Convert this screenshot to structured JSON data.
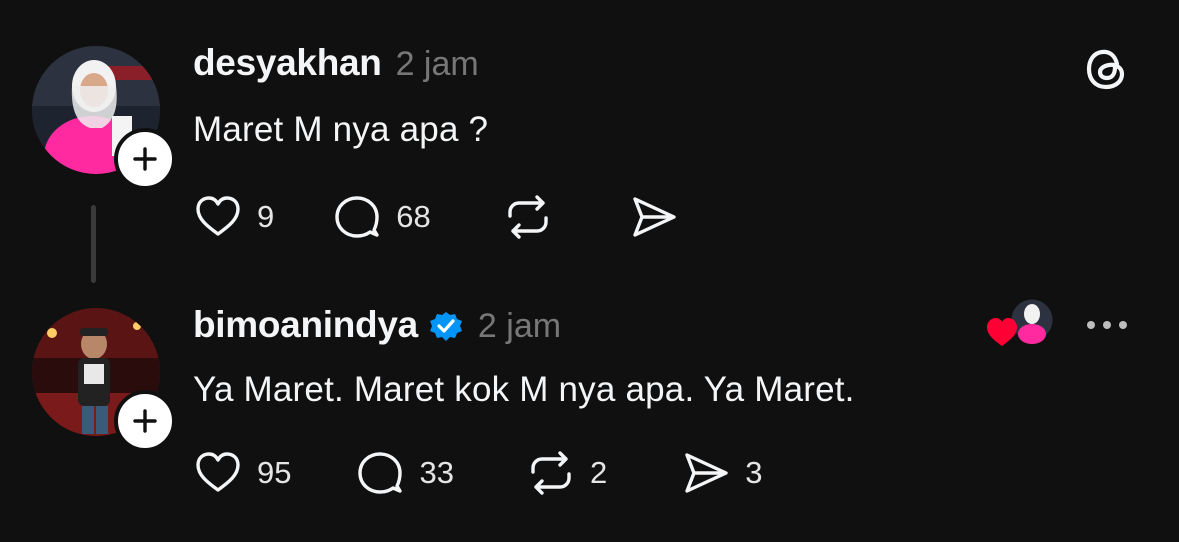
{
  "posts": [
    {
      "username": "desyakhan",
      "time": "2 jam",
      "text": "Maret M nya apa ?",
      "likes": "9",
      "replies": "68",
      "reposts": "",
      "shares": ""
    },
    {
      "username": "bimoanindya",
      "time": "2 jam",
      "text": "Ya Maret. Maret kok M nya apa. Ya Maret.",
      "likes": "95",
      "replies": "33",
      "reposts": "2",
      "shares": "3",
      "verified": true
    }
  ],
  "icons": {
    "logo": "threads-logo-icon",
    "like": "heart-icon",
    "reply": "comment-icon",
    "repost": "repost-icon",
    "share": "send-icon",
    "follow": "plus-icon",
    "more": "more-icon",
    "verified": "verified-badge-icon",
    "liked_by": "liked-by-author-icon"
  },
  "colors": {
    "background": "#101010",
    "text": "#f3f5f7",
    "muted": "#777777",
    "verified": "#0095f6",
    "liked_heart": "#ff0034"
  }
}
